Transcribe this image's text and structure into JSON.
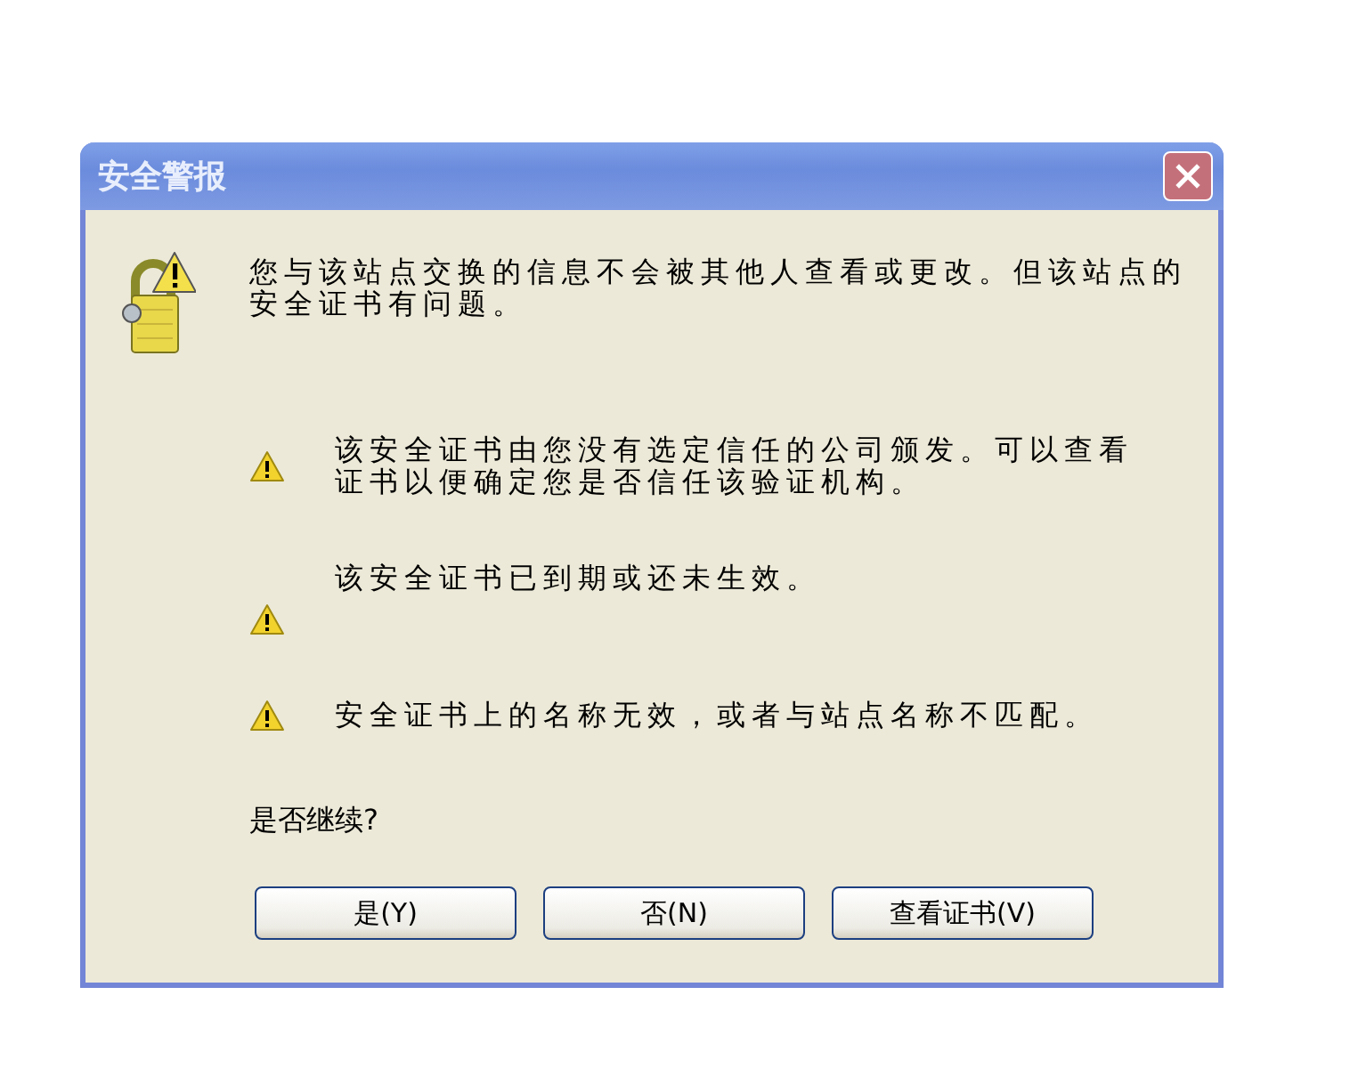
{
  "window": {
    "title": "安全警报"
  },
  "message": "您与该站点交换的信息不会被其他人查看或更改。但该站点的安全证书有问题。",
  "warnings": [
    {
      "text": "该安全证书由您没有选定信任的公司颁发。可以查看证书以便确定您是否信任该验证机构。"
    },
    {
      "text": "该安全证书已到期或还未生效。"
    },
    {
      "text": "安全证书上的名称无效，或者与站点名称不匹配。"
    }
  ],
  "question": "是否继续?",
  "buttons": [
    "是(Y)",
    "否(N)",
    "查看证书(V)"
  ]
}
